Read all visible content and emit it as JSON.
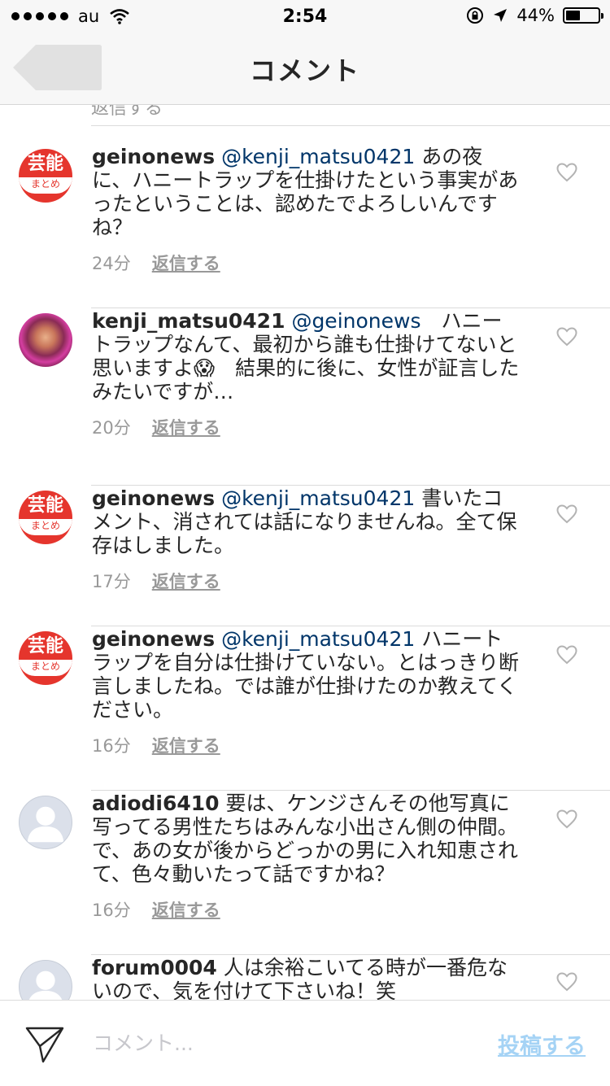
{
  "status_bar": {
    "carrier": "au",
    "time": "2:54",
    "battery_text": "44%",
    "battery_level": 0.44
  },
  "nav": {
    "title": "コメント"
  },
  "partial_top_reply": "返信する",
  "reply_label": "返信する",
  "comments": [
    {
      "avatar": "geino",
      "avatar_text_top": "芸能",
      "avatar_text_bottom": "まとめ",
      "username": "geinonews",
      "mention": "@kenji_matsu0421",
      "text_line1": " あの夜",
      "text_rest": "に、ハニートラップを仕掛けたという事実があったということは、認めたでよろしいんですね？",
      "time": "24分"
    },
    {
      "avatar": "photo",
      "username": "kenji_matsu0421",
      "mention": "@geinonews",
      "text_line1": "　ハニー",
      "text_rest": "トラップなんて、最初から誰も仕掛けてないと思いますよ😱　結果的に後に、女性が証言したみたいですが…",
      "time": "20分"
    },
    {
      "avatar": "geino",
      "avatar_text_top": "芸能",
      "avatar_text_bottom": "まとめ",
      "username": "geinonews",
      "mention": "@kenji_matsu0421",
      "text_line1": " 書いたコ",
      "text_rest": "メント、消されては話になりませんね。全て保存はしました。",
      "time": "17分"
    },
    {
      "avatar": "geino",
      "avatar_text_top": "芸能",
      "avatar_text_bottom": "まとめ",
      "username": "geinonews",
      "mention": "@kenji_matsu0421",
      "text_line1": " ハニート",
      "text_rest": "ラップを自分は仕掛けていない。とはっきり断言しましたね。では誰が仕掛けたのか教えてください。",
      "time": "16分"
    },
    {
      "avatar": "default",
      "username": "adiodi6410",
      "mention": "",
      "text_line1": " 要は、ケンジさんその他写真に",
      "text_rest": "写ってる男性たちはみんな小出さん側の仲間。で、あの女が後からどっかの男に入れ知恵されて、色々動いたって話ですかね？",
      "time": "16分"
    },
    {
      "avatar": "default",
      "username": "forum0004",
      "mention": "",
      "text_line1": " 人は余裕こいてる時が一番危な",
      "text_rest": "いので、気を付けて下さいね！笑",
      "time": ""
    }
  ],
  "input_bar": {
    "placeholder": "コメント...",
    "post_label": "投稿する"
  }
}
